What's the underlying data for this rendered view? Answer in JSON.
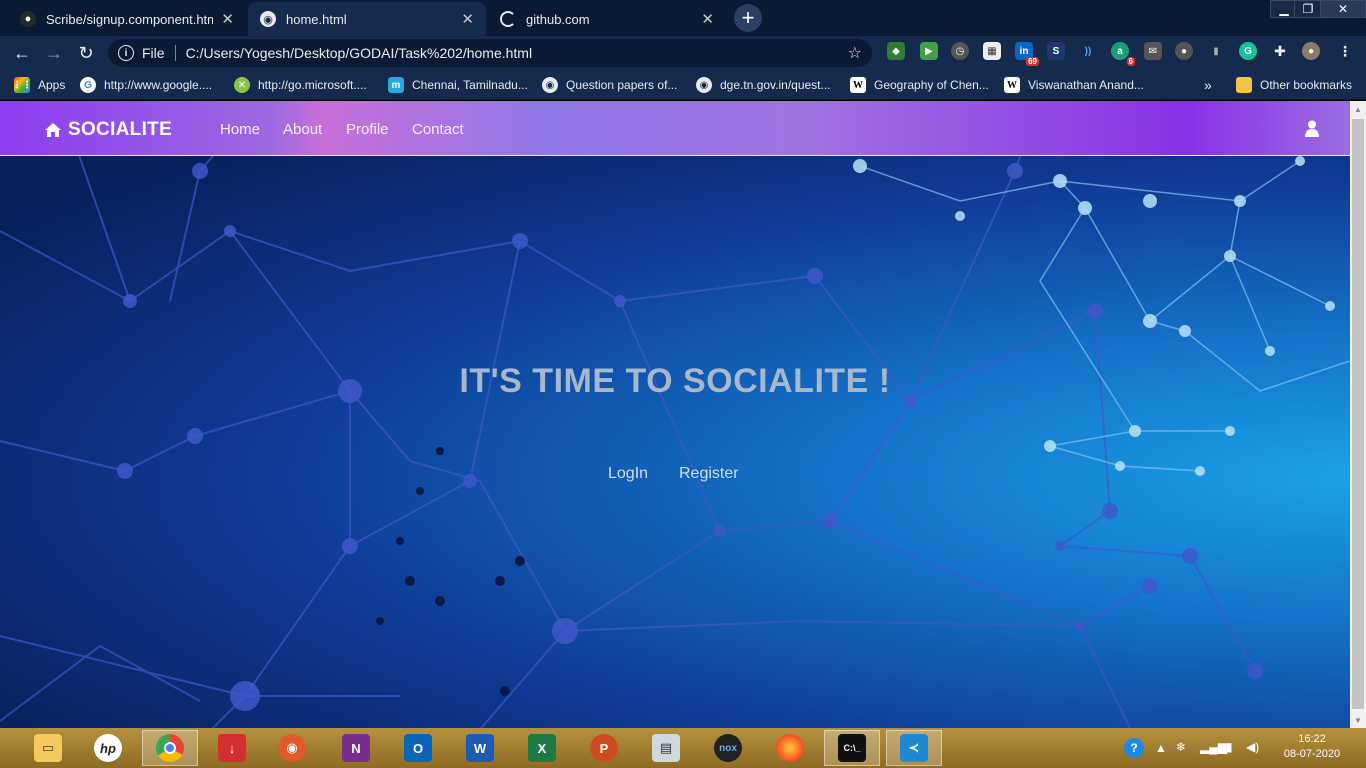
{
  "browser": {
    "tabs": [
      {
        "title": "Scribe/signup.component.html a",
        "active": false
      },
      {
        "title": "home.html",
        "active": true
      },
      {
        "title": "github.com",
        "active": false
      }
    ],
    "new_tab_symbol": "+",
    "window_controls": {
      "minimize": "▁",
      "restore": "❐",
      "close": "✕"
    },
    "toolbar": {
      "scheme_label": "File",
      "url": "C:/Users/Yogesh/Desktop/GODAI/Task%202/home.html"
    },
    "extension_badges": {
      "ext1": "69",
      "ext2": "6"
    },
    "bookmarks": [
      {
        "label": "Apps",
        "icon": "apps-grid-icon"
      },
      {
        "label": "http://www.google....",
        "icon": "google-icon"
      },
      {
        "label": "http://go.microsoft....",
        "icon": "xbox-icon"
      },
      {
        "label": "Chennai, Tamilnadu...",
        "icon": "m-icon"
      },
      {
        "label": "Question papers of...",
        "icon": "globe-icon"
      },
      {
        "label": "dge.tn.gov.in/quest...",
        "icon": "globe-icon"
      },
      {
        "label": "Geography of Chen...",
        "icon": "wikipedia-icon"
      },
      {
        "label": "Viswanathan Anand...",
        "icon": "wikipedia-icon"
      }
    ],
    "bookmarks_overflow": "»",
    "other_bookmarks": "Other bookmarks"
  },
  "site": {
    "brand": "SOCIALITE",
    "nav": [
      "Home",
      "About",
      "Profile",
      "Contact"
    ],
    "hero_title": "IT'S TIME TO SOCIALITE !",
    "login_label": "LogIn",
    "register_label": "Register"
  },
  "taskbar": {
    "time": "16:22",
    "date": "08-07-2020"
  },
  "colors": {
    "navbar_accent": "#8a2fe6",
    "hero_blue": "#1470c6",
    "taskbar_gold": "#b5913f"
  }
}
